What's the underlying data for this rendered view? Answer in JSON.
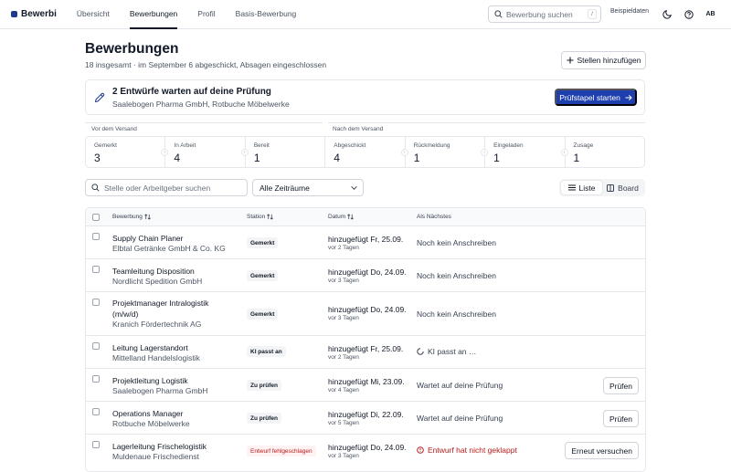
{
  "nav": {
    "logo": "Bewerbi",
    "links": [
      "Übersicht",
      "Bewerbungen",
      "Profil",
      "Basis-Bewerbung"
    ],
    "search_placeholder": "Bewerbung suchen",
    "search_shortcut": "/",
    "sample_data": "Beispieldaten",
    "avatar": "AB"
  },
  "header": {
    "title": "Bewerbungen",
    "subtitle": "18 insgesamt · im September 6 abgeschickt, Absagen eingeschlossen",
    "add_button": "Stellen hinzufügen"
  },
  "review": {
    "title": "2 Entwürfe warten auf deine Prüfung",
    "subtitle": "Saalebogen Pharma GmbH, Rotbuche Möbelwerke",
    "button": "Prüfstapel starten"
  },
  "groups": {
    "before": "Vor dem Versand",
    "after": "Nach dem Versand"
  },
  "stats": [
    {
      "label": "Gemerkt",
      "value": "3"
    },
    {
      "label": "In Arbeit",
      "value": "4"
    },
    {
      "label": "Bereit",
      "value": "1"
    },
    {
      "label": "Abgeschickt",
      "value": "4"
    },
    {
      "label": "Rückmeldung",
      "value": "1"
    },
    {
      "label": "Eingeladen",
      "value": "1"
    },
    {
      "label": "Zusage",
      "value": "1"
    }
  ],
  "filters": {
    "search_placeholder": "Stelle oder Arbeitgeber suchen",
    "period": "Alle Zeiträume",
    "view_list": "Liste",
    "view_board": "Board"
  },
  "table": {
    "headers": {
      "job": "Bewerbung",
      "station": "Station",
      "date": "Datum",
      "next": "Als Nächstes"
    },
    "rows": [
      {
        "title": "Supply Chain Planer",
        "company": "Elbtal Getränke GmbH & Co. KG",
        "station": "Gemerkt",
        "date": "hinzugefügt Fr, 25.09.",
        "ago": "vor 2 Tagen",
        "next": "Noch kein Anschreiben",
        "action": ""
      },
      {
        "title": "Teamleitung Disposition",
        "company": "Nordlicht Spedition GmbH",
        "station": "Gemerkt",
        "date": "hinzugefügt Do, 24.09.",
        "ago": "vor 3 Tagen",
        "next": "Noch kein Anschreiben",
        "action": ""
      },
      {
        "title": "Projektmanager Intralogistik (m/w/d)",
        "company": "Kranich Fördertechnik AG",
        "station": "Gemerkt",
        "date": "hinzugefügt Do, 24.09.",
        "ago": "vor 3 Tagen",
        "next": "Noch kein Anschreiben",
        "action": ""
      },
      {
        "title": "Leitung Lagerstandort",
        "company": "Mittelland Handelslogistik",
        "station": "KI passt an",
        "date": "hinzugefügt Fr, 25.09.",
        "ago": "vor 2 Tagen",
        "next": "KI passt an …",
        "action": ""
      },
      {
        "title": "Projektleitung Logistik",
        "company": "Saalebogen Pharma GmbH",
        "station": "Zu prüfen",
        "date": "hinzugefügt Mi, 23.09.",
        "ago": "vor 4 Tagen",
        "next": "Wartet auf deine Prüfung",
        "action": "Prüfen"
      },
      {
        "title": "Operations Manager",
        "company": "Rotbuche Möbelwerke",
        "station": "Zu prüfen",
        "date": "hinzugefügt Di, 22.09.",
        "ago": "vor 5 Tagen",
        "next": "Wartet auf deine Prüfung",
        "action": "Prüfen"
      },
      {
        "title": "Lagerleitung Frischelogistik",
        "company": "Muldenaue Frischedienst",
        "station": "Entwurf fehlgeschlagen",
        "date": "hinzugefügt Do, 24.09.",
        "ago": "vor 3 Tagen",
        "next": "Entwurf hat nicht geklappt",
        "action": "Erneut versuchen"
      }
    ]
  },
  "colors": {
    "accent": "#1e40af",
    "error": "#b91c1c"
  }
}
